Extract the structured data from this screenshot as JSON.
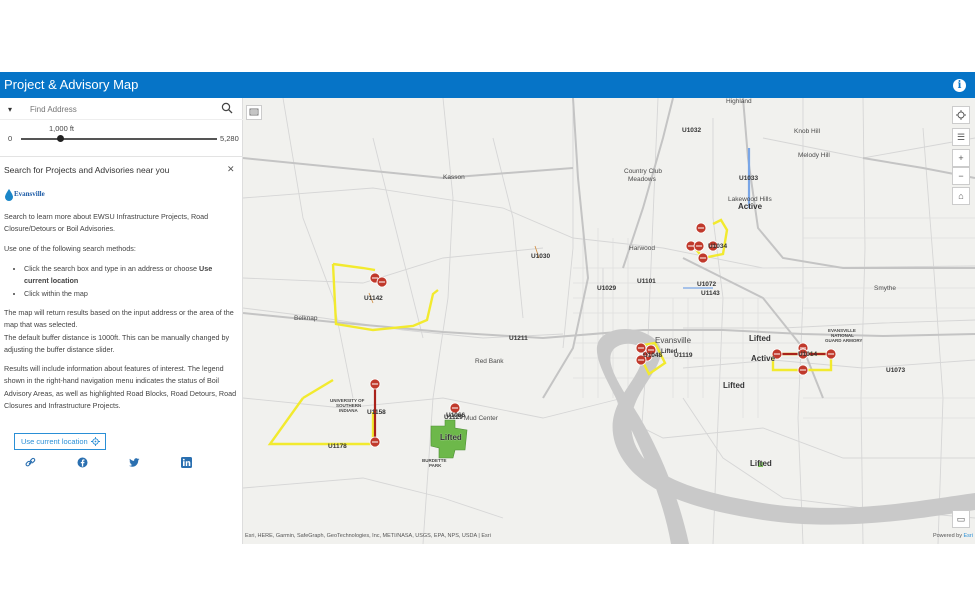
{
  "header": {
    "title": "Project & Advisory Map",
    "info_icon": "info-icon"
  },
  "search": {
    "placeholder": "Find Address"
  },
  "slider": {
    "min_label": "0",
    "max_label": "5,280",
    "value_label": "1,000 ft",
    "value": 1000
  },
  "panel": {
    "heading": "Search for Projects and Advisories near you",
    "logo_text": "Evansville",
    "intro": "Search to learn more about EWSU Infrastructure Projects, Road Closure/Detours or Boil Advisories.",
    "methods_intro": "Use one of the following search methods:",
    "method_1_prefix": "Click the search box and type in an address or choose ",
    "method_1_bold": "Use current location",
    "method_2": "Click within the map",
    "results_1": "The map will return results based on the input address or the area of the map that was selected.",
    "results_2": "The default buffer distance is 1000ft. This can be manually changed by adjusting the buffer distance slider.",
    "results_3": "Results will include information about features of interest. The legend shown in the right-hand navigation menu indicates the status of Boil Advisory Areas, as well as highlighted Road Blocks, Road Detours, Road Closures and Infrastructure Projects.",
    "use_location_label": "Use current location"
  },
  "map": {
    "places": [
      {
        "t": "Highland"
      },
      {
        "t": "Knob Hill"
      },
      {
        "t": "Melody Hill"
      },
      {
        "t": "Kasson"
      },
      {
        "t": "Country Club"
      },
      {
        "t": "Meadows"
      },
      {
        "t": "Lakewood Hills"
      },
      {
        "t": "Harwood"
      },
      {
        "t": "Smythe"
      },
      {
        "t": "Belknap"
      },
      {
        "t": "Evansville"
      },
      {
        "t": "Red Bank"
      },
      {
        "t": "Mud Center"
      },
      {
        "t": "UNIVERSITY OF"
      },
      {
        "t": "SOUTHERN"
      },
      {
        "t": "INDIANA"
      },
      {
        "t": "BURDETTE"
      },
      {
        "t": "PARK"
      },
      {
        "t": "EVANSVILLE"
      },
      {
        "t": "NATIONAL"
      },
      {
        "t": "GUARD ARMORY"
      }
    ],
    "routes": [
      "U1032",
      "U1033",
      "U1030",
      "U1142",
      "U1029",
      "U1101",
      "U1072",
      "U1143",
      "U1211",
      "U1119",
      "U1158",
      "U1129",
      "U1178",
      "U1073",
      "U1034",
      "U1048",
      "U1014",
      "U1066"
    ],
    "tags": [
      "Active",
      "Lifted",
      "Active",
      "Lifted",
      "Lifted",
      "Lifted",
      "Lifted"
    ],
    "attribution": "Esri, HERE, Garmin, SafeGraph, GeoTechnologies, Inc, METI/NASA, USGS, EPA, NPS, USDA | Esri",
    "powered_prefix": "Powered by ",
    "powered_link": "Esri"
  },
  "colors": {
    "header": "#0674c7",
    "accent": "#2a8fd6",
    "road_block": "#c0392b",
    "detour": "#f2ea2e",
    "lifted": "#6db84a",
    "river": "#c9c9c9"
  }
}
